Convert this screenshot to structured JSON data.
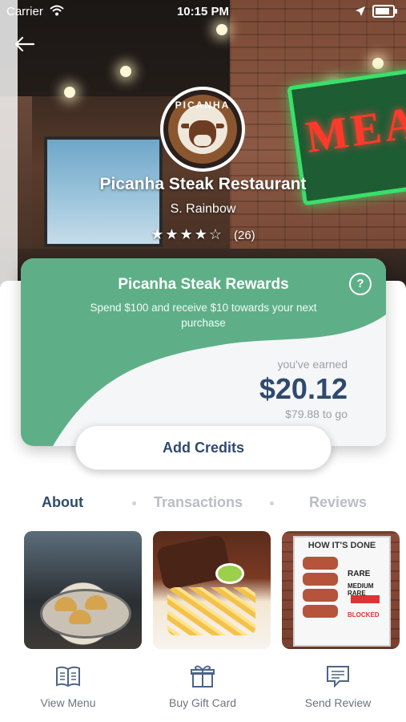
{
  "status_bar": {
    "carrier": "Carrier",
    "time": "10:15 PM"
  },
  "restaurant": {
    "name": "Picanha Steak Restaurant",
    "location": "S. Rainbow",
    "stars": "★★★★☆",
    "rating_count": "(26)",
    "logo_text": "PICANHA",
    "neon_sign_text": "MEAT"
  },
  "rewards": {
    "title": "Picanha Steak Rewards",
    "subtitle": "Spend $100 and receive $10 towards your next purchase",
    "help": "?",
    "earned_label": "you've earned",
    "earned_amount": "$20.12",
    "to_go": "$79.88 to go",
    "add_credits": "Add Credits",
    "accent_color": "#5eaf87"
  },
  "tabs": [
    {
      "label": "About"
    },
    {
      "label": "Transactions"
    },
    {
      "label": "Reviews"
    }
  ],
  "photos": {
    "photo3_title": "HOW IT'S DONE",
    "photo3_rare": "RARE",
    "photo3_medium_rare": "MEDIUM RARE",
    "photo3_blocked": "BLOCKED"
  },
  "actions": [
    {
      "label": "View Menu",
      "icon": "book-icon"
    },
    {
      "label": "Buy Gift Card",
      "icon": "gift-icon"
    },
    {
      "label": "Send Review",
      "icon": "review-icon"
    }
  ],
  "colors": {
    "navy": "#2f4a6d",
    "tab_inactive": "#b9bec4"
  }
}
